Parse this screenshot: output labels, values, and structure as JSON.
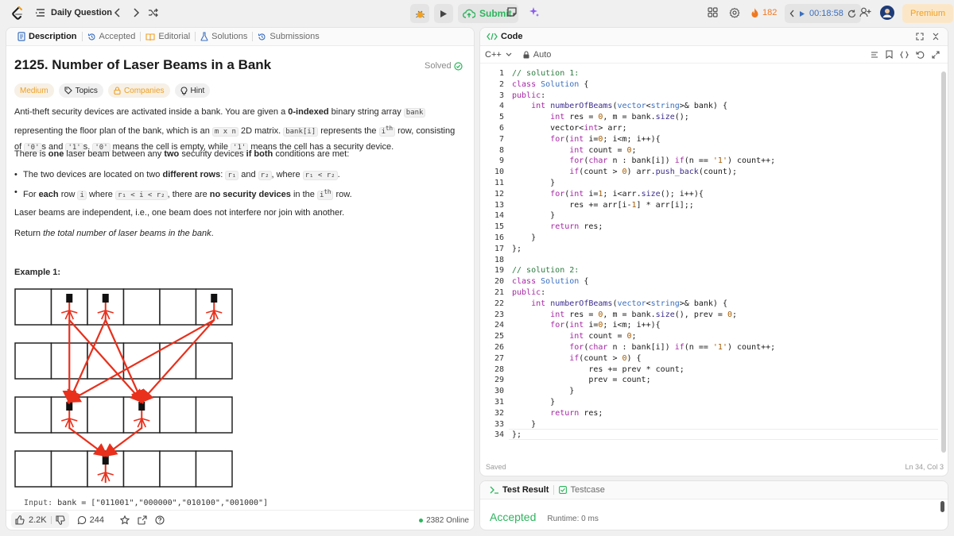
{
  "nav": {
    "title": "Daily Question",
    "submit_label": "Submit",
    "streak": "182",
    "timer": "00:18:58",
    "premium_label": "Premium"
  },
  "left_tabs": [
    {
      "label": "Description"
    },
    {
      "label": "Accepted"
    },
    {
      "label": "Editorial"
    },
    {
      "label": "Solutions"
    },
    {
      "label": "Submissions"
    }
  ],
  "problem": {
    "title": "2125. Number of Laser Beams in a Bank",
    "status": "Solved",
    "tags": [
      "Medium",
      "Topics",
      "Companies",
      "Hint"
    ],
    "p1a": "Anti-theft security devices are activated inside a bank. You are given a ",
    "p1b": "0-indexed",
    "p1c": " binary string array ",
    "p1d": "bank",
    "p1e": " representing the floor plan of the bank, which is an ",
    "p1f": "m x n",
    "p1g": " 2D matrix. ",
    "p1h": "bank[i]",
    "p1i": " represents the ",
    "p1j": "i",
    "p1k": "th",
    "p1l": " row, consisting of ",
    "p1m": "'0'",
    "p1n": "s and ",
    "p1o": "'1'",
    "p1p": "s. ",
    "p1q": "'0'",
    "p1r": " means the cell is empty, while ",
    "p1s": "'1'",
    "p1t": " means the cell has a security device.",
    "p2a": "There is ",
    "p2b": "one",
    "p2c": " laser beam between any ",
    "p2d": "two",
    "p2e": " security devices ",
    "p2f": "if both",
    "p2g": " conditions are met:",
    "b1a": "The two devices are located on two ",
    "b1b": "different rows",
    "b1c": ": ",
    "b1d": "r₁",
    "b1e": " and ",
    "b1f": "r₂",
    "b1g": ", where ",
    "b1h": "r₁ < r₂",
    "b1i": ".",
    "b2a": "For ",
    "b2b": "each",
    "b2c": " row ",
    "b2d": "i",
    "b2e": " where ",
    "b2f": "r₁ < i < r₂",
    "b2g": ", there are ",
    "b2h": "no security devices",
    "b2i": " in the ",
    "b2j": "i",
    "b2k": "th",
    "b2l": " row.",
    "p3": "Laser beams are independent, i.e., one beam does not interfere nor join with another.",
    "p4a": "Return ",
    "p4b": "the total number of laser beams in the bank",
    "p4c": ".",
    "example_title": "Example 1:",
    "input_label": "Input:",
    "input_value": "bank = [\"011001\",\"000000\",\"010100\",\"001000\"]"
  },
  "bottom": {
    "likes": "2.2K",
    "comments": "244",
    "online": "2382 Online"
  },
  "code": {
    "header": "Code",
    "language": "C++",
    "mode": "Auto",
    "status": "Saved",
    "cursor": "Ln 34, Col 3"
  },
  "result": {
    "tab1": "Test Result",
    "tab2": "Testcase",
    "verdict": "Accepted",
    "runtime": "Runtime: 0 ms"
  },
  "bank_rows": [
    "011001",
    "000000",
    "010100",
    "001000"
  ],
  "colors": {
    "accent_green": "#2db55d",
    "medium_orange": "#f0a020",
    "laser_red": "#e8301c"
  }
}
